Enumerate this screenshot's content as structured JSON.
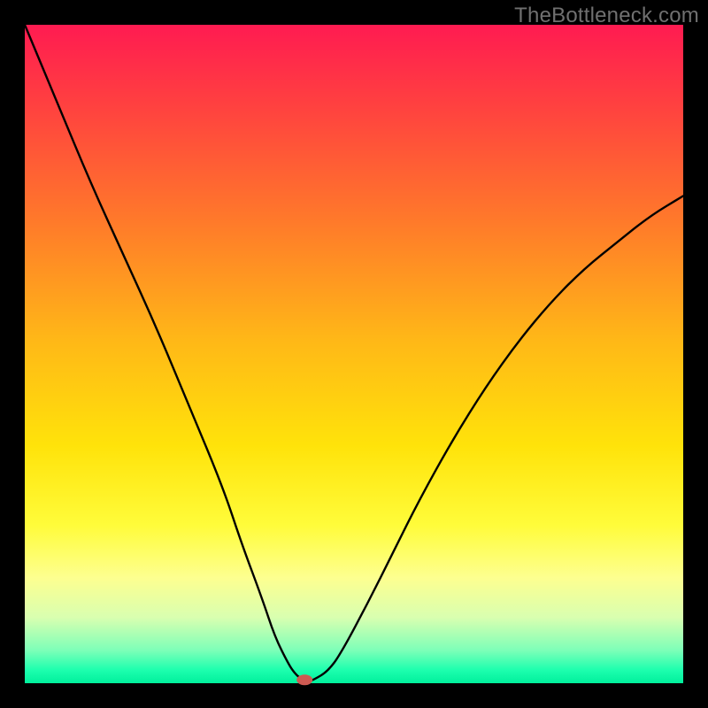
{
  "watermark": "TheBottleneck.com",
  "chart_data": {
    "type": "line",
    "title": "",
    "xlabel": "",
    "ylabel": "",
    "xlim": [
      0,
      100
    ],
    "ylim": [
      0,
      100
    ],
    "grid": false,
    "legend": false,
    "series": [
      {
        "name": "bottleneck-curve",
        "x": [
          0,
          5,
          10,
          15,
          20,
          25,
          30,
          33,
          36,
          38,
          40,
          41,
          42,
          43,
          44,
          46,
          48,
          52,
          56,
          60,
          65,
          70,
          75,
          80,
          85,
          90,
          95,
          100
        ],
        "y": [
          100,
          88,
          76,
          65,
          54,
          42,
          30,
          21,
          13,
          7,
          3,
          1.5,
          0.6,
          0.2,
          0.6,
          1.8,
          4.5,
          12,
          20,
          28,
          37,
          45,
          52,
          58,
          63,
          67,
          71,
          74
        ]
      }
    ],
    "marker": {
      "x": 42.5,
      "y": 0.5,
      "color": "#cd5a52"
    },
    "background_gradient": {
      "top": "#ff1b51",
      "bottom": "#00f09c"
    }
  }
}
